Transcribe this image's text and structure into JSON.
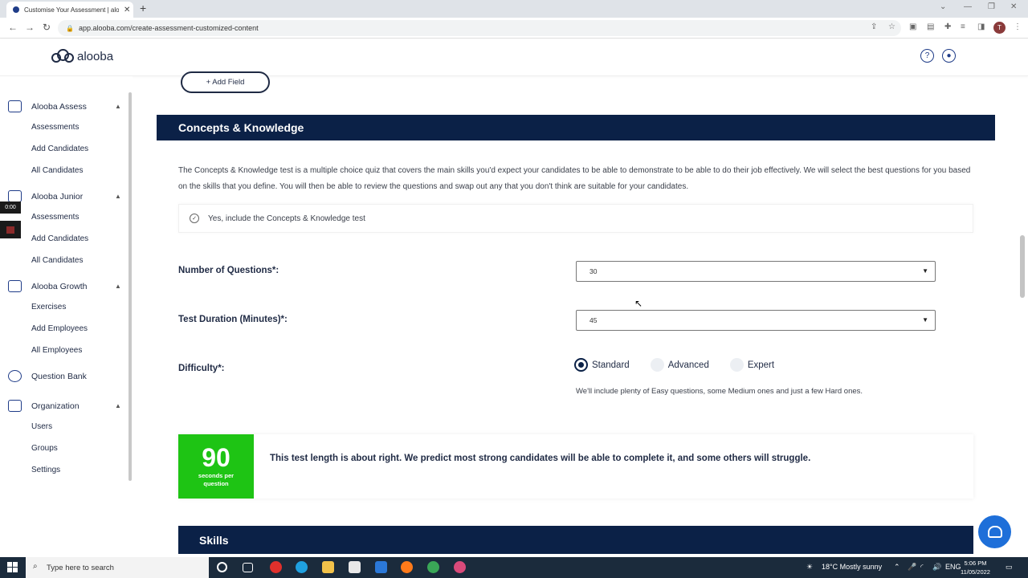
{
  "browser": {
    "tab_title": "Customise Your Assessment | alo",
    "url": "app.alooba.com/create-assessment-customized-content",
    "profile_initial": "T"
  },
  "header": {
    "logo_text": "alooba"
  },
  "sidebar": {
    "timer": "0:00",
    "sections": [
      {
        "label": "Alooba Assess",
        "items": [
          "Assessments",
          "Add Candidates",
          "All Candidates"
        ]
      },
      {
        "label": "Alooba Junior",
        "items": [
          "Assessments",
          "Add Candidates",
          "All Candidates"
        ]
      },
      {
        "label": "Alooba Growth",
        "items": [
          "Exercises",
          "Add Employees",
          "All Employees"
        ]
      },
      {
        "label": "Question Bank",
        "items": []
      },
      {
        "label": "Organization",
        "items": [
          "Users",
          "Groups",
          "Settings"
        ]
      }
    ]
  },
  "main": {
    "add_field_label": "+ Add Field",
    "section_title": "Concepts & Knowledge",
    "description": "The Concepts & Knowledge test is a multiple choice quiz that covers the main skills you'd expect your candidates to be able to demonstrate to be able to do their job effectively. We will select the best questions for you based on the skills that you define. You will then be able to review the questions and swap out any that you don't think are suitable for your candidates.",
    "include_label": "Yes, include the Concepts & Knowledge test",
    "questions_label": "Number of Questions*:",
    "questions_value": "30",
    "duration_label": "Test Duration (Minutes)*:",
    "duration_value": "45",
    "difficulty_label": "Difficulty*:",
    "difficulty_options": [
      "Standard",
      "Advanced",
      "Expert"
    ],
    "difficulty_selected": "Standard",
    "difficulty_note": "We'll include plenty of Easy questions, some Medium ones and just a few Hard ones.",
    "result_number": "90",
    "result_unit": "seconds per question",
    "result_text": "This test length is about right. We predict most strong candidates will be able to complete it, and some others will struggle.",
    "skills_title": "Skills"
  },
  "taskbar": {
    "search_placeholder": "Type here to search",
    "weather": "18°C  Mostly sunny",
    "language": "ENG",
    "time": "5:06 PM",
    "date": "11/05/2022"
  },
  "colors": {
    "navy": "#0b2147",
    "green": "#1ec414",
    "chat": "#1e6fd9"
  }
}
